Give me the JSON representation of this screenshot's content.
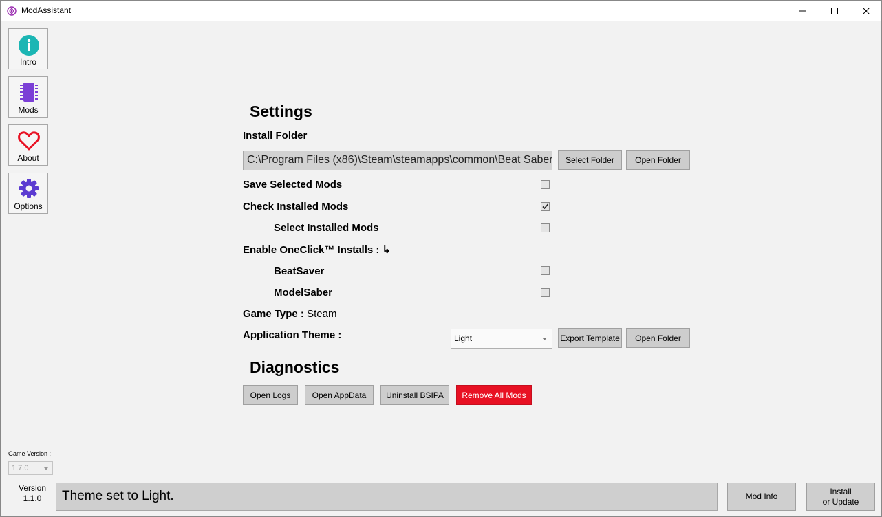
{
  "window": {
    "title": "ModAssistant"
  },
  "nav": [
    {
      "label": "Intro",
      "icon": "info-icon"
    },
    {
      "label": "Mods",
      "icon": "chip-icon"
    },
    {
      "label": "About",
      "icon": "heart-icon"
    },
    {
      "label": "Options",
      "icon": "gear-icon"
    }
  ],
  "settings": {
    "heading": "Settings",
    "install_folder_label": "Install Folder",
    "install_folder_value": "C:\\Program Files (x86)\\Steam\\steamapps\\common\\Beat Saber",
    "select_folder": "Select Folder",
    "open_folder": "Open Folder",
    "save_selected_mods": {
      "label": "Save Selected Mods",
      "checked": false
    },
    "check_installed_mods": {
      "label": "Check Installed Mods",
      "checked": true
    },
    "select_installed_mods": {
      "label": "Select Installed Mods",
      "checked": false
    },
    "oneclick_label": "Enable OneClick™ Installs : ↳",
    "beatsaver": {
      "label": "BeatSaver",
      "checked": false
    },
    "modelsaber": {
      "label": "ModelSaber",
      "checked": false
    },
    "game_type_label": "Game Type :",
    "game_type_value": "Steam",
    "theme_label": "Application Theme :",
    "theme_value": "Light",
    "export_template": "Export Template",
    "theme_open_folder": "Open Folder"
  },
  "diagnostics": {
    "heading": "Diagnostics",
    "open_logs": "Open Logs",
    "open_appdata": "Open AppData",
    "uninstall_bsipa": "Uninstall BSIPA",
    "remove_all_mods": "Remove All Mods"
  },
  "footer": {
    "game_version_label": "Game Version :",
    "game_version_value": "1.7.0",
    "version_label": "Version",
    "version_value": "1.1.0",
    "status": "Theme set to Light.",
    "mod_info": "Mod Info",
    "install_line1": "Install",
    "install_line2": "or Update"
  },
  "colors": {
    "accent_teal": "#1cb6b4",
    "accent_purple": "#7b3fd6",
    "heart_red": "#e81123",
    "gear_purple": "#5b3bd1",
    "danger": "#e81123"
  }
}
